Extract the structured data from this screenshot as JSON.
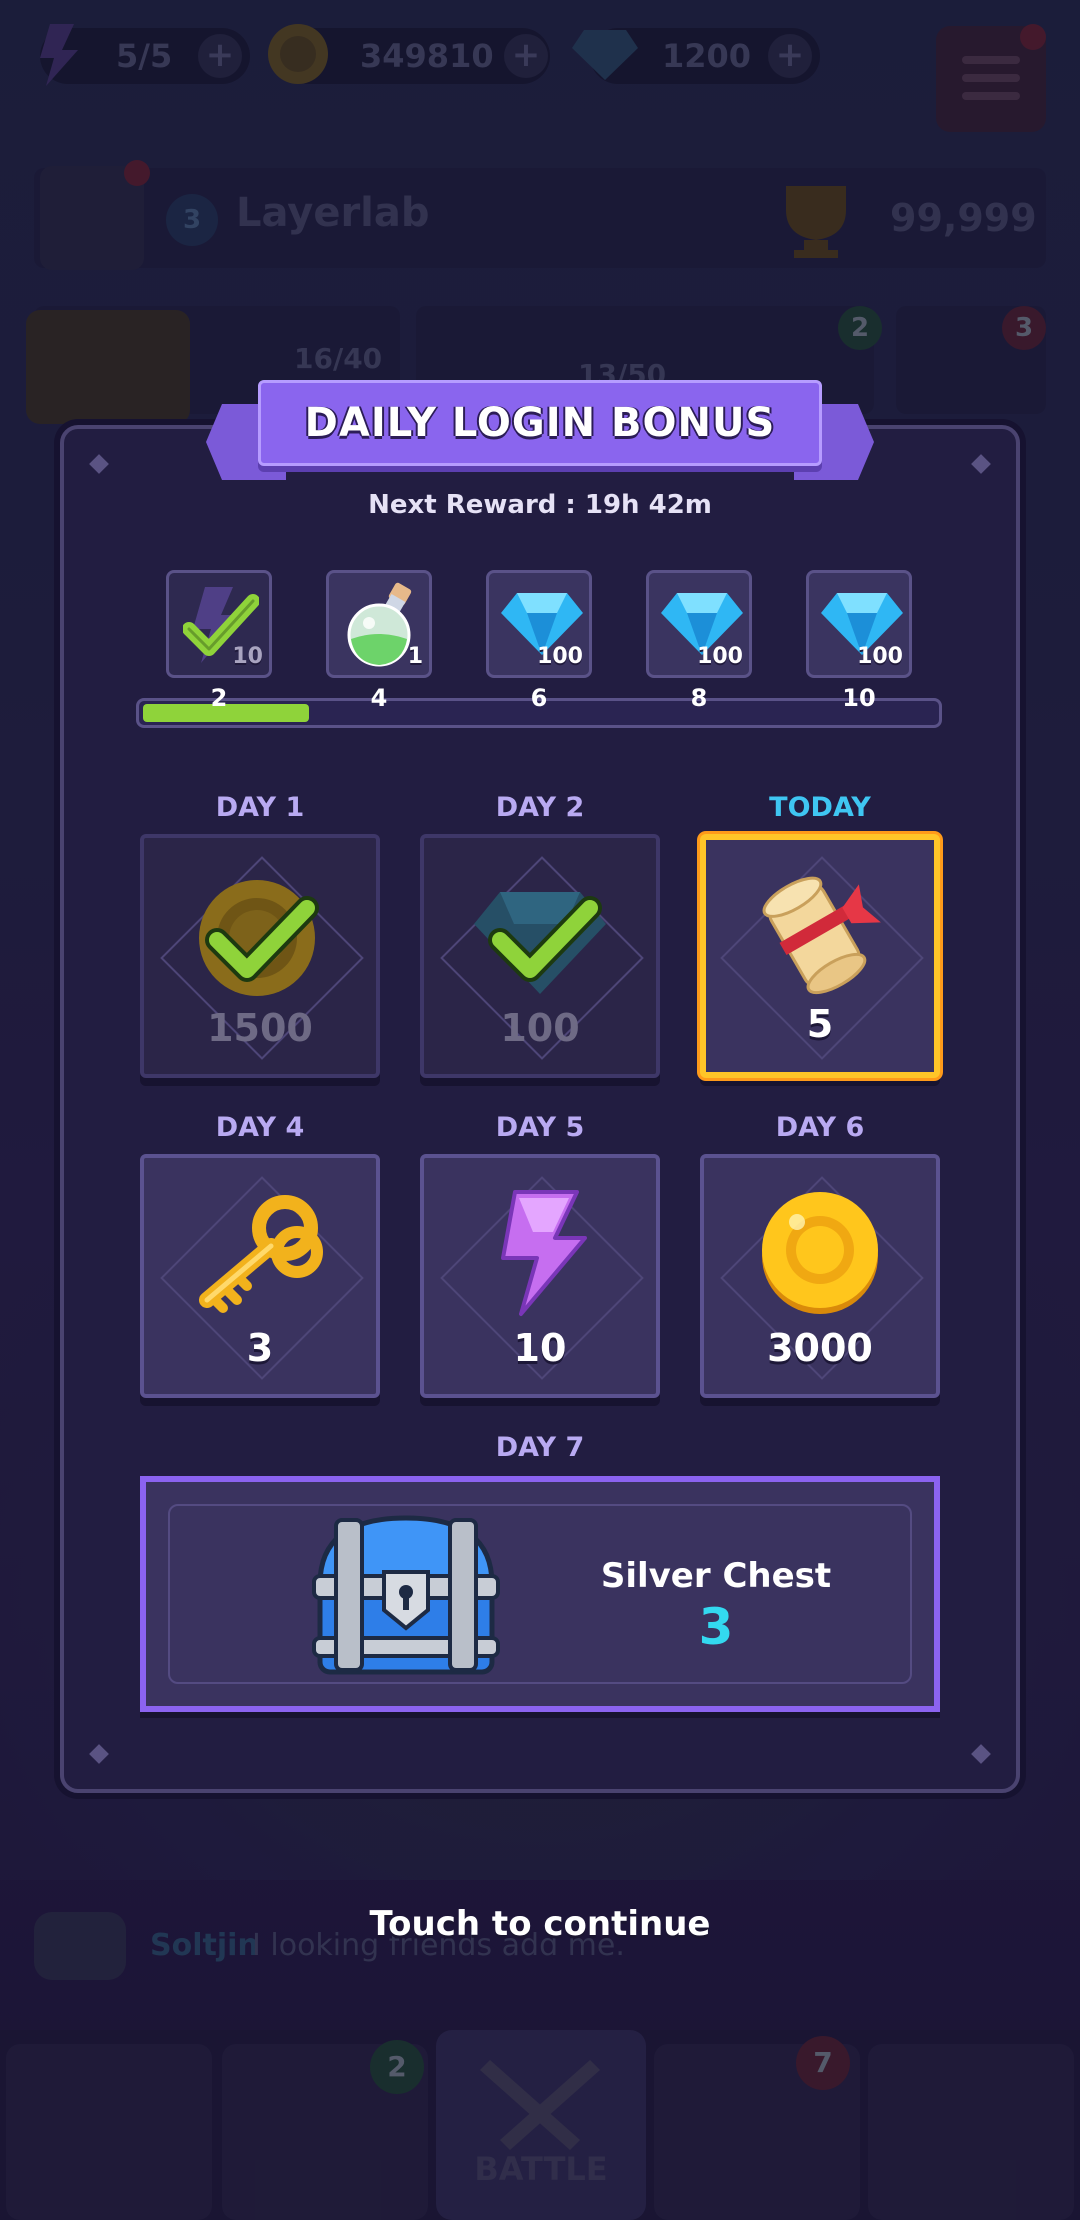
{
  "top_bar": {
    "energy": "5/5",
    "gold": "349810",
    "gems": "1200"
  },
  "profile": {
    "level": "3",
    "name": "Layerlab",
    "trophies": "99,999"
  },
  "quests": {
    "progress_a": "16/40",
    "progress_b": "13/50",
    "badge_a": "2",
    "badge_b": "3"
  },
  "chat": {
    "user": "Soltjin",
    "message": "I looking friends add me."
  },
  "bottom_nav": {
    "battle_label": "BATTLE",
    "badge_cards": "2",
    "badge_chest": "7"
  },
  "modal": {
    "title": "DAILY LOGIN BONUS",
    "next_reward": "Next Reward : 19h 42m",
    "milestones": [
      {
        "step": "2",
        "qty": "10",
        "item": "energy",
        "claimed": true
      },
      {
        "step": "4",
        "qty": "1",
        "item": "potion",
        "claimed": false
      },
      {
        "step": "6",
        "qty": "100",
        "item": "gem",
        "claimed": false
      },
      {
        "step": "8",
        "qty": "100",
        "item": "gem",
        "claimed": false
      },
      {
        "step": "10",
        "qty": "100",
        "item": "gem",
        "claimed": false
      }
    ],
    "progress_fraction": 0.21,
    "days": [
      {
        "label": "DAY 1",
        "amount": "1500",
        "item": "gold-coin",
        "state": "claimed"
      },
      {
        "label": "DAY 2",
        "amount": "100",
        "item": "gem",
        "state": "claimed"
      },
      {
        "label": "TODAY",
        "amount": "5",
        "item": "scroll",
        "state": "today"
      },
      {
        "label": "DAY 4",
        "amount": "3",
        "item": "key",
        "state": "locked"
      },
      {
        "label": "DAY 5",
        "amount": "10",
        "item": "energy",
        "state": "locked"
      },
      {
        "label": "DAY 6",
        "amount": "3000",
        "item": "gold-coin",
        "state": "locked"
      }
    ],
    "day7": {
      "label": "DAY 7",
      "name": "Silver Chest",
      "amount": "3",
      "item": "silver-chest"
    },
    "touch_to_continue": "Touch to continue"
  },
  "colors": {
    "accent_purple": "#8a65ee",
    "today_border": "#ffc528",
    "check_green": "#8fd33a",
    "today_label": "#3fc6f2",
    "chest_count": "#33d9f0"
  }
}
